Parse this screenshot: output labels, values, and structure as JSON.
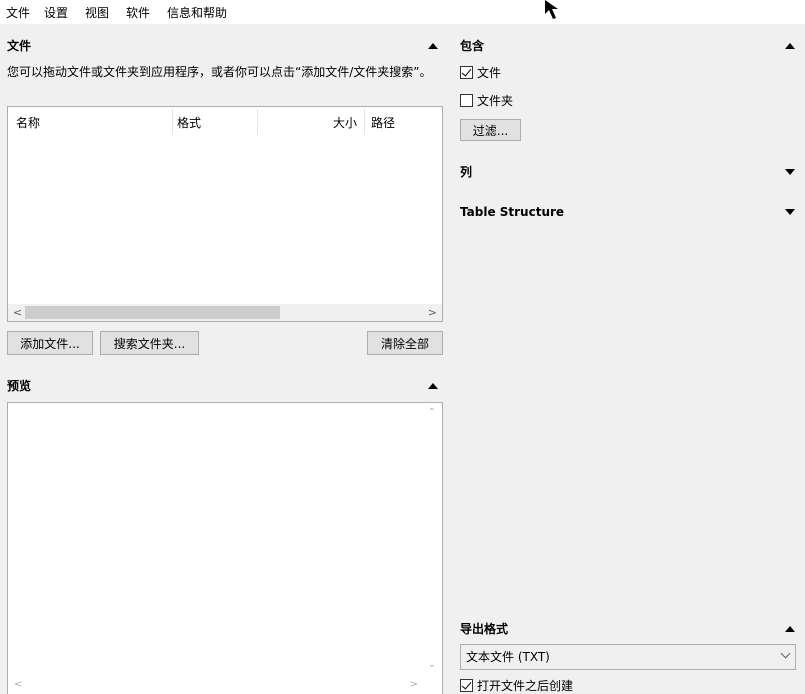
{
  "menu": [
    "文件",
    "设置",
    "视图",
    "软件",
    "信息和帮助"
  ],
  "files": {
    "title": "文件",
    "description": "您可以拖动文件或文件夹到应用程序，或者你可以点击“添加文件/文件夹搜索”。",
    "columns": [
      "名称",
      "格式",
      "大小",
      "路径"
    ],
    "add_file": "添加文件...",
    "search_folder": "搜索文件夹...",
    "clear_all": "清除全部"
  },
  "preview": {
    "title": "预览"
  },
  "include": {
    "title": "包含",
    "file_label": "文件",
    "file_checked": true,
    "folder_label": "文件夹",
    "folder_checked": false,
    "filter_button": "过滤..."
  },
  "columns_section": {
    "title": "列"
  },
  "table_structure": {
    "title": "Table Structure"
  },
  "export": {
    "title": "导出格式",
    "selected": "文本文件 (TXT)",
    "open_after_label": "打开文件之后创建",
    "open_after_checked": true
  }
}
